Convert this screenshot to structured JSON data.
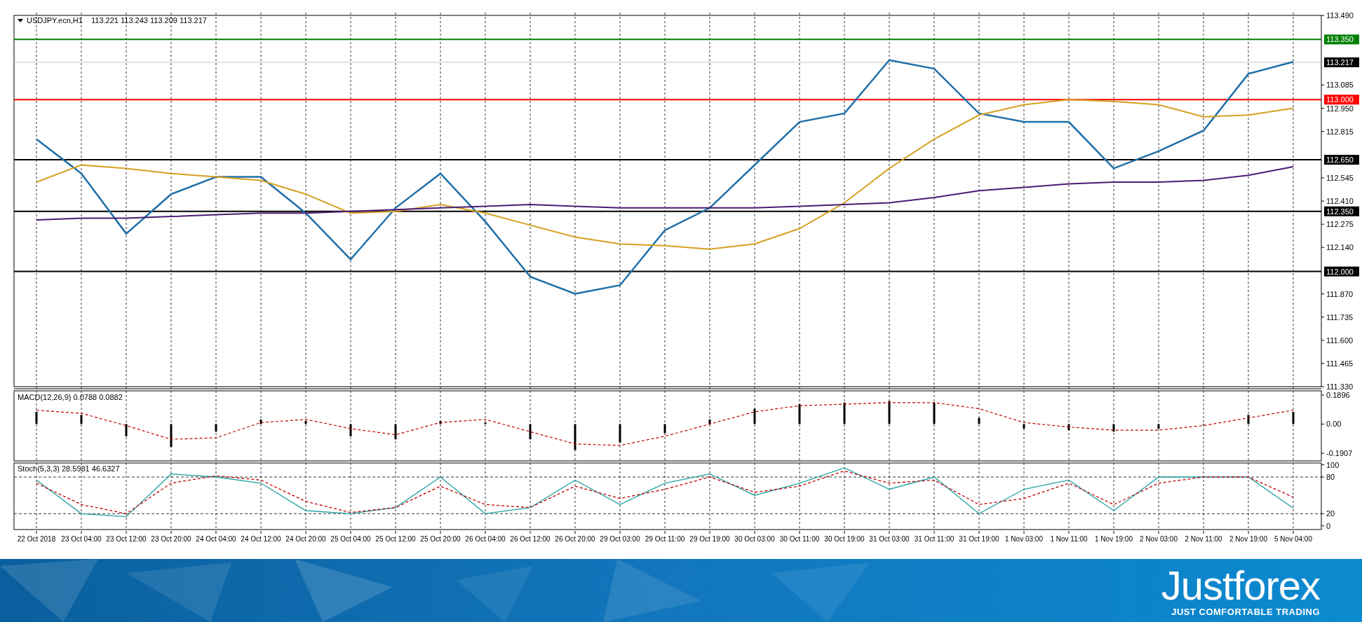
{
  "price_panel": {
    "quote": "113.221 113.243 113.209 113.217",
    "chart_data": {
      "type": "line",
      "title": "USDJPY.ecn,H1",
      "grid": true,
      "series": [
        {
          "color": "#1f6fa8",
          "values": [
            112.77,
            112.57,
            112.22,
            112.45,
            112.55,
            112.55,
            112.34,
            112.07,
            112.37,
            112.57,
            112.29,
            111.97,
            111.87,
            111.92,
            112.24,
            112.37,
            112.62,
            112.87,
            112.92,
            113.23,
            113.18,
            112.92,
            112.87,
            112.87,
            112.6,
            112.7,
            112.82,
            113.15,
            113.22
          ]
        },
        {
          "color": "#d4a020",
          "values": [
            112.52,
            112.62,
            112.6,
            112.57,
            112.55,
            112.53,
            112.45,
            112.34,
            112.35,
            112.39,
            112.34,
            112.27,
            112.2,
            112.16,
            112.15,
            112.13,
            112.16,
            112.25,
            112.4,
            112.6,
            112.77,
            112.91,
            112.97,
            113.0,
            112.99,
            112.97,
            112.9,
            112.91,
            112.95
          ]
        },
        {
          "color": "#4b1c74",
          "values": [
            112.3,
            112.31,
            112.31,
            112.32,
            112.33,
            112.34,
            112.34,
            112.35,
            112.36,
            112.37,
            112.38,
            112.39,
            112.38,
            112.37,
            112.37,
            112.37,
            112.37,
            112.38,
            112.39,
            112.4,
            112.43,
            112.47,
            112.49,
            112.51,
            112.52,
            112.52,
            112.53,
            112.56,
            112.61
          ]
        }
      ],
      "ylim": [
        111.33,
        113.49
      ],
      "yticks": [
        {
          "value": 113.49,
          "label": "113.490"
        },
        {
          "value": 113.085,
          "label": "113.085"
        },
        {
          "value": 112.95,
          "label": "112.950"
        },
        {
          "value": 112.815,
          "label": "112.815"
        },
        {
          "value": 112.545,
          "label": "112.545"
        },
        {
          "value": 112.41,
          "label": "112.410"
        },
        {
          "value": 112.275,
          "label": "112.275"
        },
        {
          "value": 112.14,
          "label": "112.140"
        },
        {
          "value": 111.87,
          "label": "111.870"
        },
        {
          "value": 111.735,
          "label": "111.735"
        },
        {
          "value": 111.6,
          "label": "111.600"
        },
        {
          "value": 111.465,
          "label": "111.465"
        },
        {
          "value": 111.33,
          "label": "111.330"
        }
      ],
      "ref_lines": [
        {
          "axis": "y",
          "value": 113.35,
          "label": "113.350",
          "color": "#008000"
        },
        {
          "axis": "y",
          "value": 113.217,
          "label": "113.217",
          "color": "#c0c0c0"
        },
        {
          "axis": "y",
          "value": 113.0,
          "label": "113.000",
          "color": "#ff0000"
        },
        {
          "axis": "y",
          "value": 112.65,
          "label": "112.650",
          "color": "#000000"
        },
        {
          "axis": "y",
          "value": 112.35,
          "label": "112.350",
          "color": "#000000"
        },
        {
          "axis": "y",
          "value": 112.0,
          "label": "112.000",
          "color": "#000000"
        }
      ]
    }
  },
  "macd_panel": {
    "chart_data": {
      "type": "bar",
      "title": "MACD(12,26,9) 0.0788 0.0882",
      "grid": true,
      "ylim": [
        -0.241,
        0.217
      ],
      "yticks": [
        {
          "value": 0.1896,
          "label": "0.1896"
        },
        {
          "value": 0,
          "label": "0.00"
        },
        {
          "value": -0.1907,
          "label": "-0.1907"
        }
      ],
      "series": [
        {
          "color": "#000000",
          "values": [
            0.08,
            0.06,
            -0.08,
            -0.15,
            -0.05,
            0.03,
            0.02,
            -0.08,
            -0.1,
            0.02,
            0.01,
            -0.1,
            -0.17,
            -0.12,
            -0.06,
            0.03,
            0.1,
            0.13,
            0.14,
            0.15,
            0.14,
            0.04,
            -0.03,
            -0.04,
            -0.05,
            -0.03,
            0.0,
            0.06,
            0.08
          ]
        },
        {
          "type": "line",
          "line_style": "dashed",
          "color": "#c00000",
          "values": [
            0.09,
            0.07,
            -0.01,
            -0.1,
            -0.09,
            0.01,
            0.03,
            -0.03,
            -0.07,
            0.01,
            0.03,
            -0.05,
            -0.13,
            -0.14,
            -0.08,
            0.0,
            0.08,
            0.12,
            0.13,
            0.14,
            0.14,
            0.1,
            0.01,
            -0.02,
            -0.04,
            -0.04,
            -0.01,
            0.04,
            0.09
          ]
        }
      ]
    }
  },
  "stoch_panel": {
    "chart_data": {
      "type": "line",
      "title": "Stoch(5,3,3) 28.5981 46.6327",
      "grid": true,
      "ylim": [
        -6,
        103
      ],
      "yticks": [
        100,
        80,
        20,
        0
      ],
      "categories": [
        "22 Oct 2018",
        "23 Oct 04:00",
        "23 Oct 12:00",
        "23 Oct 20:00",
        "24 Oct 04:00",
        "24 Oct 12:00",
        "24 Oct 20:00",
        "25 Oct 04:00",
        "25 Oct 12:00",
        "25 Oct 20:00",
        "26 Oct 04:00",
        "26 Oct 12:00",
        "26 Oct 20:00",
        "29 Oct 03:00",
        "29 Oct 11:00",
        "29 Oct 19:00",
        "30 Oct 03:00",
        "30 Oct 11:00",
        "30 Oct 19:00",
        "31 Oct 03:00",
        "31 Oct 11:00",
        "31 Oct 19:00",
        "1 Nov 03:00",
        "1 Nov 11:00",
        "1 Nov 19:00",
        "2 Nov 03:00",
        "2 Nov 11:00",
        "2 Nov 19:00",
        "5 Nov 04:00"
      ],
      "series": [
        {
          "line_style": "solid",
          "color": "#20a0a0",
          "values": [
            75,
            20,
            15,
            85,
            80,
            70,
            25,
            20,
            30,
            80,
            20,
            30,
            75,
            35,
            70,
            85,
            50,
            70,
            95,
            60,
            80,
            20,
            60,
            75,
            25,
            80,
            80,
            80,
            29
          ]
        },
        {
          "line_style": "dashed",
          "color": "#c00000",
          "values": [
            70,
            35,
            20,
            70,
            82,
            75,
            40,
            22,
            30,
            65,
            35,
            30,
            65,
            45,
            60,
            80,
            55,
            65,
            90,
            70,
            75,
            35,
            45,
            70,
            35,
            70,
            80,
            80,
            47
          ]
        }
      ]
    }
  },
  "brand": {
    "name": "Justforex",
    "tagline": "JUST COMFORTABLE TRADING"
  }
}
